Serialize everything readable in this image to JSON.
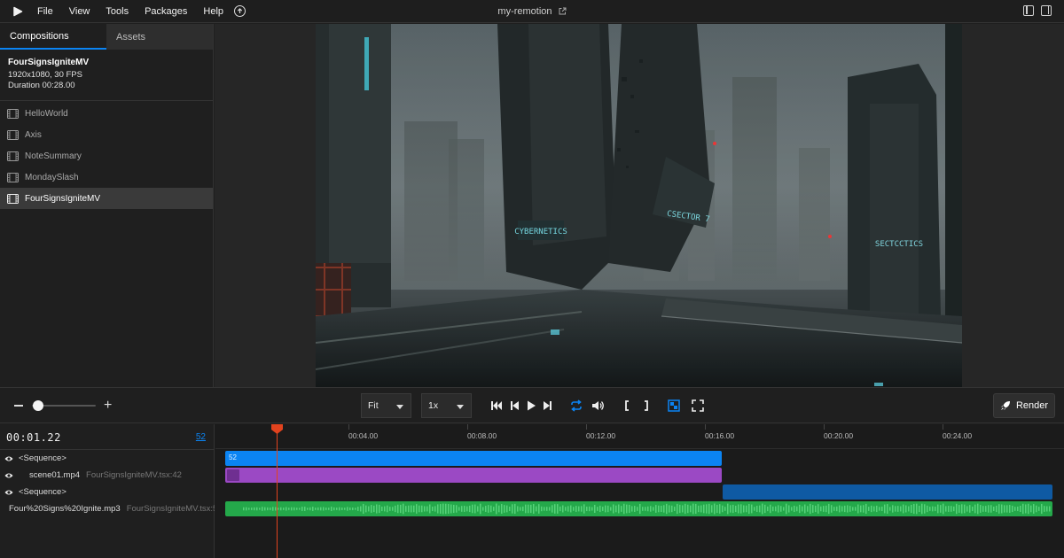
{
  "menubar": {
    "items": [
      "File",
      "View",
      "Tools",
      "Packages",
      "Help"
    ],
    "project_title": "my-remotion"
  },
  "sidebar": {
    "tabs": [
      "Compositions",
      "Assets"
    ],
    "selected": {
      "name": "FourSignsIgniteMV",
      "resolution": "1920x1080, 30 FPS",
      "duration": "Duration 00:28.00"
    },
    "compositions": [
      "HelloWorld",
      "Axis",
      "NoteSummary",
      "MondaySlash",
      "FourSignsIgniteMV"
    ]
  },
  "preview": {
    "signs": [
      "CYBERNETICS",
      "CSECTOR 7",
      "SECTCCTICS"
    ]
  },
  "controls": {
    "zoom_fit": "Fit",
    "playback_rate": "1x",
    "render_label": "Render",
    "zoom_level": 0.1
  },
  "timeline": {
    "timecode": "00:01.22",
    "frame": "52",
    "ruler_labels": [
      "00:04.00",
      "00:08.00",
      "00:12.00",
      "00:16.00",
      "00:20.00",
      "00:24.00"
    ],
    "tracks": [
      {
        "label": "<Sequence>",
        "sub": "",
        "type": "sequence"
      },
      {
        "label": "scene01.mp4",
        "sub": "FourSignsIgniteMV.tsx:42",
        "type": "video"
      },
      {
        "label": "<Sequence>",
        "sub": "",
        "type": "sequence"
      },
      {
        "label": "Four%20Signs%20Ignite.mp3",
        "sub": "FourSignsIgniteMV.tsx:5!",
        "type": "audio"
      }
    ],
    "clip_label": "52"
  },
  "colors": {
    "accent": "#0b84f3",
    "sequence_clip": "#0b84f3",
    "video_clip": "#9b49c4",
    "second_sequence": "#0f5aa3",
    "audio_clip": "#24a84a",
    "playhead": "#e2431e"
  }
}
